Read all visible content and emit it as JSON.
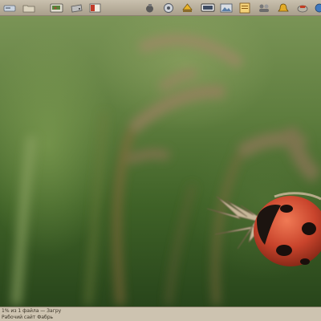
{
  "launcher": {
    "left_icons": [
      {
        "name": "disk-icon",
        "color": "#9aa7b8"
      },
      {
        "name": "folder-icon",
        "color": "#8d8a80"
      },
      {
        "name": "terminal-icon",
        "color": "#6b8f4b"
      },
      {
        "name": "drive-icon",
        "color": "#a5a5a5"
      },
      {
        "name": "red-book-icon",
        "color": "#b73a2a"
      }
    ],
    "right_icons": [
      {
        "name": "audio-icon",
        "color": "#5f5f5f"
      },
      {
        "name": "network-icon",
        "color": "#7a7f86"
      },
      {
        "name": "package-icon",
        "color": "#d6a020"
      },
      {
        "name": "monitor-icon",
        "color": "#3f4d63"
      },
      {
        "name": "image-viewer-icon",
        "color": "#5c7fa8"
      },
      {
        "name": "notes-icon",
        "color": "#c88a22"
      },
      {
        "name": "users-icon",
        "color": "#6d6d6d"
      },
      {
        "name": "bell-icon",
        "color": "#d49b1d"
      },
      {
        "name": "flag-icon",
        "color": "#c13d22"
      },
      {
        "name": "globe-icon",
        "color": "#3f79bf"
      }
    ]
  },
  "status": {
    "line1": "1% из 1 файла — Загру",
    "line2": "Рабочий сайт Фабрь"
  },
  "colors": {
    "panel": "#cdc3b0",
    "wallpaper_green": "#4f7232",
    "ladybug_red": "#c9442c"
  }
}
